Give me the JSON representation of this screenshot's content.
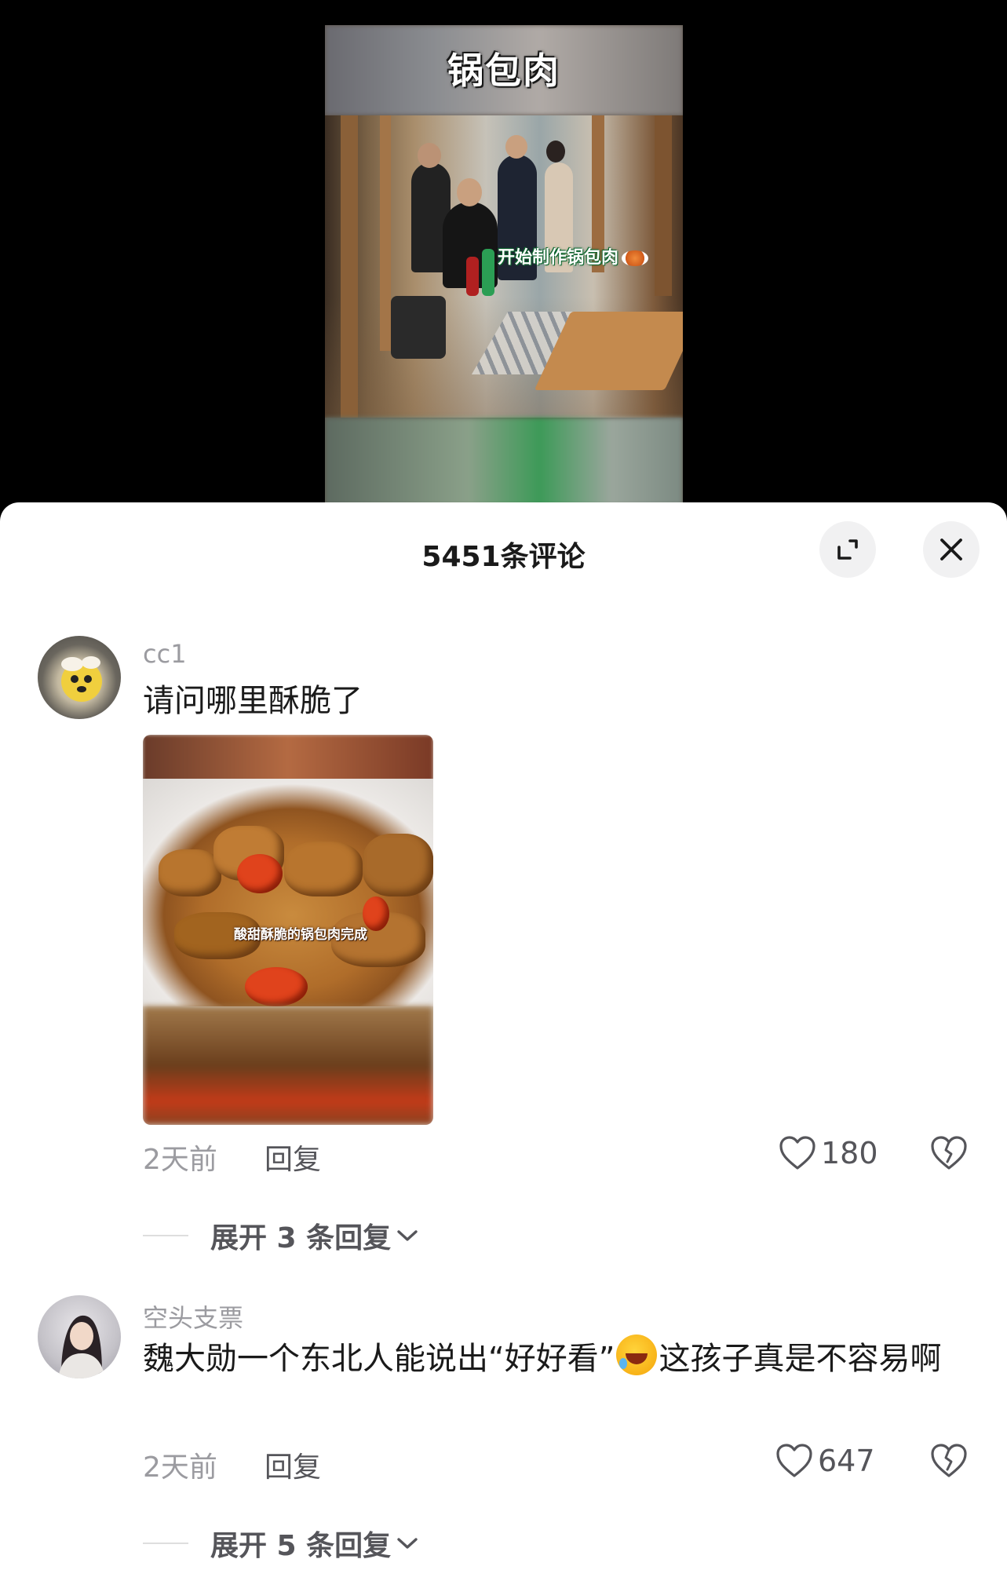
{
  "video": {
    "title": "锅包肉",
    "caption": "开始制作锅包肉"
  },
  "sheet": {
    "title": "5451条评论"
  },
  "comments": [
    {
      "username": "cc1",
      "text": "请问哪里酥脆了",
      "image_caption": "酸甜酥脆的锅包肉完成",
      "time": "2天前",
      "reply_label": "回复",
      "likes": "180",
      "expand_label": "展开 3 条回复"
    },
    {
      "username": "空头支票",
      "text_before": "魏大勋一个东北人能说出“好好看”",
      "text_after": "这孩子真是不容易啊",
      "emoji": "rolling-on-floor-laughing",
      "time": "2天前",
      "reply_label": "回复",
      "likes": "647",
      "expand_label": "展开 5 条回复"
    }
  ],
  "icons": {
    "expand": "expand-icon",
    "close": "close-icon",
    "heart": "heart-icon",
    "dislike": "broken-heart-icon",
    "chevron": "chevron-down-icon"
  }
}
